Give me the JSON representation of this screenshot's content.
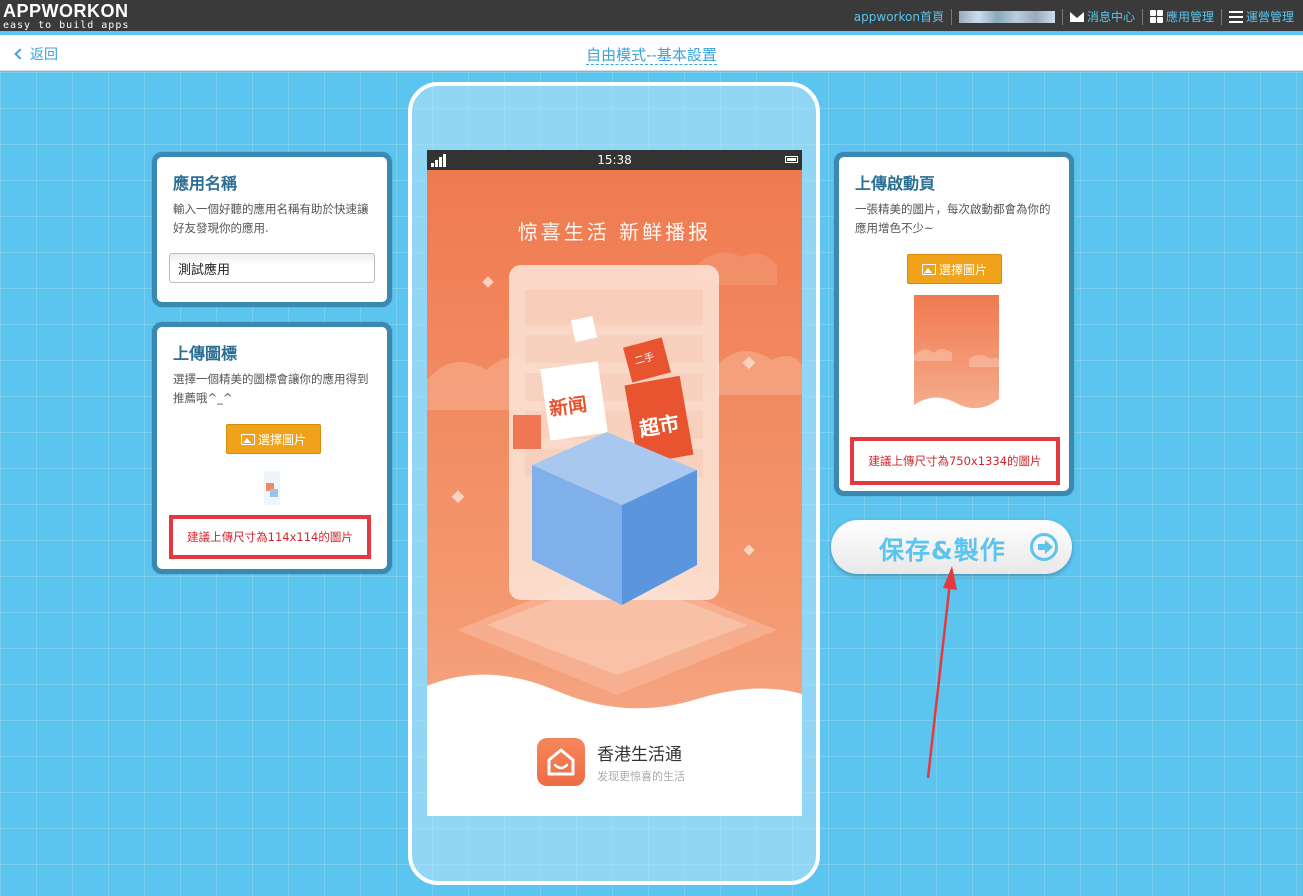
{
  "topbar": {
    "logo_main": "APPWORKON",
    "logo_sub": "easy to build apps",
    "nav": {
      "home": "appworkon首頁",
      "messages": "消息中心",
      "apps": "應用管理",
      "ops": "運營管理"
    }
  },
  "subbar": {
    "back": "返回",
    "title": "自由模式--基本設置"
  },
  "app_name_card": {
    "title": "應用名稱",
    "desc": "輸入一個好聽的應用名稱有助於快速讓好友發現你的應用.",
    "input_value": "測試應用"
  },
  "icon_card": {
    "title": "上傳圖標",
    "desc": "選擇一個精美的圖標會讓你的應用得到推薦哦^_^",
    "button": "選擇圖片",
    "hint": "建議上傳尺寸為114x114的圖片"
  },
  "launch_card": {
    "title": "上傳啟動頁",
    "desc": "一張精美的圖片，每次啟動都會為你的應用增色不少~",
    "button": "選擇圖片",
    "hint": "建議上傳尺寸為750x1334的圖片"
  },
  "phone": {
    "time": "15:38",
    "headline": "惊喜生活  新鲜播报",
    "tag_news": "新闻",
    "tag_market": "超市",
    "tag_second": "二手",
    "brand_name": "香港生活通",
    "brand_slogan": "发现更惊喜的生活"
  },
  "save_button": "保存&製作",
  "colors": {
    "accent": "#5bc4ef",
    "card_border": "#3b88b0",
    "button_orange": "#f0a21b",
    "annotation_red": "#e43a3f"
  }
}
